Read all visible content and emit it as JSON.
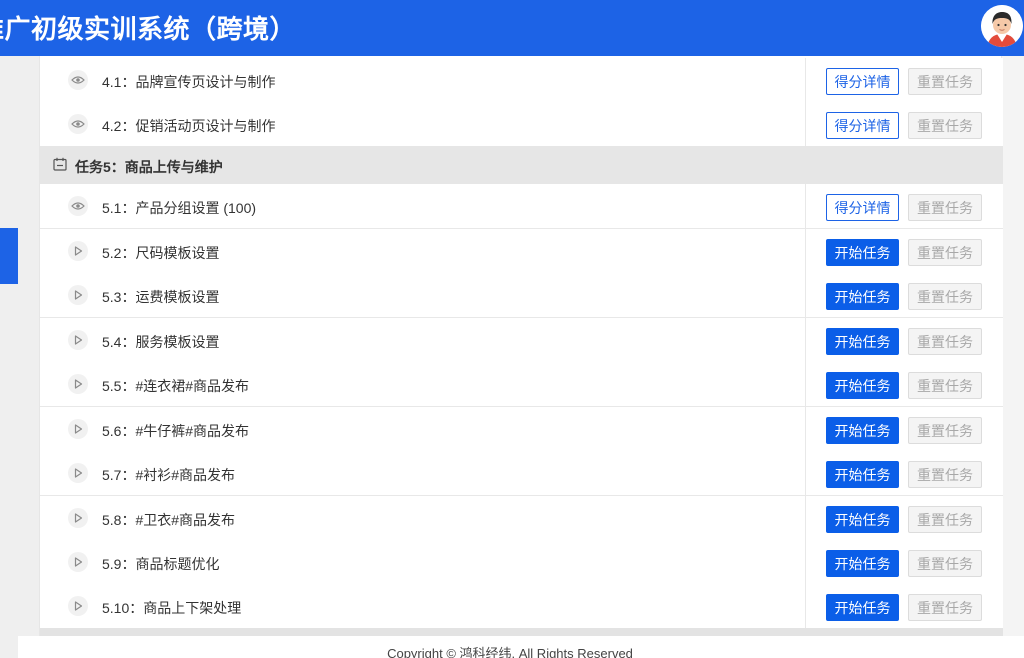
{
  "header": {
    "title": "推广初级实训系统（跨境）"
  },
  "section5": {
    "label": "任务5：商品上传与维护"
  },
  "rows": [
    {
      "label": "4.1：品牌宣传页设计与制作",
      "icon": "eye-icon",
      "primary": "得分详情",
      "primary_style": "outline",
      "reset": "重置任务"
    },
    {
      "label": "4.2：促销活动页设计与制作",
      "icon": "eye-icon",
      "primary": "得分详情",
      "primary_style": "outline",
      "reset": "重置任务"
    },
    {
      "label": "5.1：产品分组设置 (100)",
      "icon": "eye-icon",
      "primary": "得分详情",
      "primary_style": "outline",
      "reset": "重置任务"
    },
    {
      "label": "5.2：尺码模板设置",
      "icon": "play-icon",
      "primary": "开始任务",
      "primary_style": "solid",
      "reset": "重置任务"
    },
    {
      "label": "5.3：运费模板设置",
      "icon": "play-icon",
      "primary": "开始任务",
      "primary_style": "solid",
      "reset": "重置任务"
    },
    {
      "label": "5.4：服务模板设置",
      "icon": "play-icon",
      "primary": "开始任务",
      "primary_style": "solid",
      "reset": "重置任务"
    },
    {
      "label": "5.5：#连衣裙#商品发布",
      "icon": "play-icon",
      "primary": "开始任务",
      "primary_style": "solid",
      "reset": "重置任务"
    },
    {
      "label": "5.6：#牛仔裤#商品发布",
      "icon": "play-icon",
      "primary": "开始任务",
      "primary_style": "solid",
      "reset": "重置任务"
    },
    {
      "label": "5.7：#衬衫#商品发布",
      "icon": "play-icon",
      "primary": "开始任务",
      "primary_style": "solid",
      "reset": "重置任务"
    },
    {
      "label": "5.8：#卫衣#商品发布",
      "icon": "play-icon",
      "primary": "开始任务",
      "primary_style": "solid",
      "reset": "重置任务"
    },
    {
      "label": "5.9：商品标题优化",
      "icon": "play-icon",
      "primary": "开始任务",
      "primary_style": "solid",
      "reset": "重置任务"
    },
    {
      "label": "5.10：商品上下架处理",
      "icon": "play-icon",
      "primary": "开始任务",
      "primary_style": "solid",
      "reset": "重置任务"
    }
  ],
  "footer": {
    "copyright": "Copyright © 鸿科经纬. All Rights Reserved"
  },
  "colors": {
    "brand": "#1d63e6",
    "primary_button": "#0b5ee8"
  }
}
